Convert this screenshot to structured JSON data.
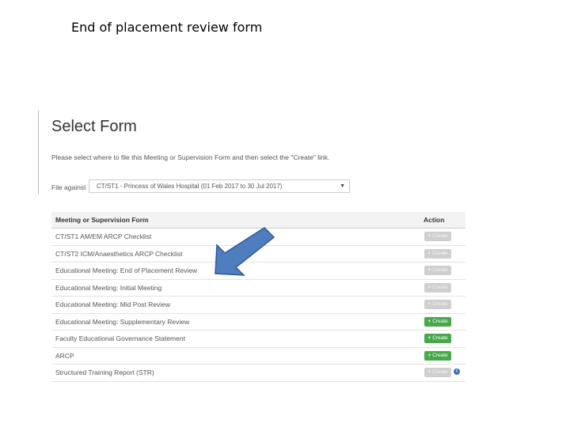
{
  "slide": {
    "title": "End of placement review form"
  },
  "form": {
    "title": "Select Form",
    "instructions": "Please select where to file this Meeting or Supervision Form and then select the \"Create\" link.",
    "file_against_label": "File against",
    "file_against_value": "CT/ST1 - Princess of Wales Hospital (01 Feb 2017 to 30 Jul 2017)",
    "caret": "▼"
  },
  "table": {
    "col_form": "Meeting or Supervision Form",
    "col_action": "Action",
    "button_label": "Create",
    "button_plus": "+",
    "rows": [
      {
        "name": "CT/ST1 AM/EM ARCP Checklist",
        "enabled": false
      },
      {
        "name": "CT/ST2 ICM/Anaesthetics ARCP Checklist",
        "enabled": false
      },
      {
        "name": "Educational Meeting: End of Placement Review",
        "enabled": false
      },
      {
        "name": "Educational Meeting: Initial Meeting",
        "enabled": false
      },
      {
        "name": "Educational Meeting: Mid Post Review",
        "enabled": false
      },
      {
        "name": "Educational Meeting: Supplementary Review",
        "enabled": true
      },
      {
        "name": "Faculty Educational Governance Statement",
        "enabled": true
      },
      {
        "name": "ARCP",
        "enabled": true
      },
      {
        "name": "Structured Training Report (STR)",
        "enabled": false,
        "info": true
      }
    ]
  },
  "colors": {
    "arrow_fill": "#4f7ec0",
    "arrow_stroke": "#2f5a93",
    "create_enabled": "#49a84a",
    "create_disabled": "#cfcfcf",
    "info": "#3a73b5"
  },
  "icons": {
    "arrow": "pointing-arrow-icon",
    "info": "info-icon",
    "plus": "plus-icon"
  }
}
